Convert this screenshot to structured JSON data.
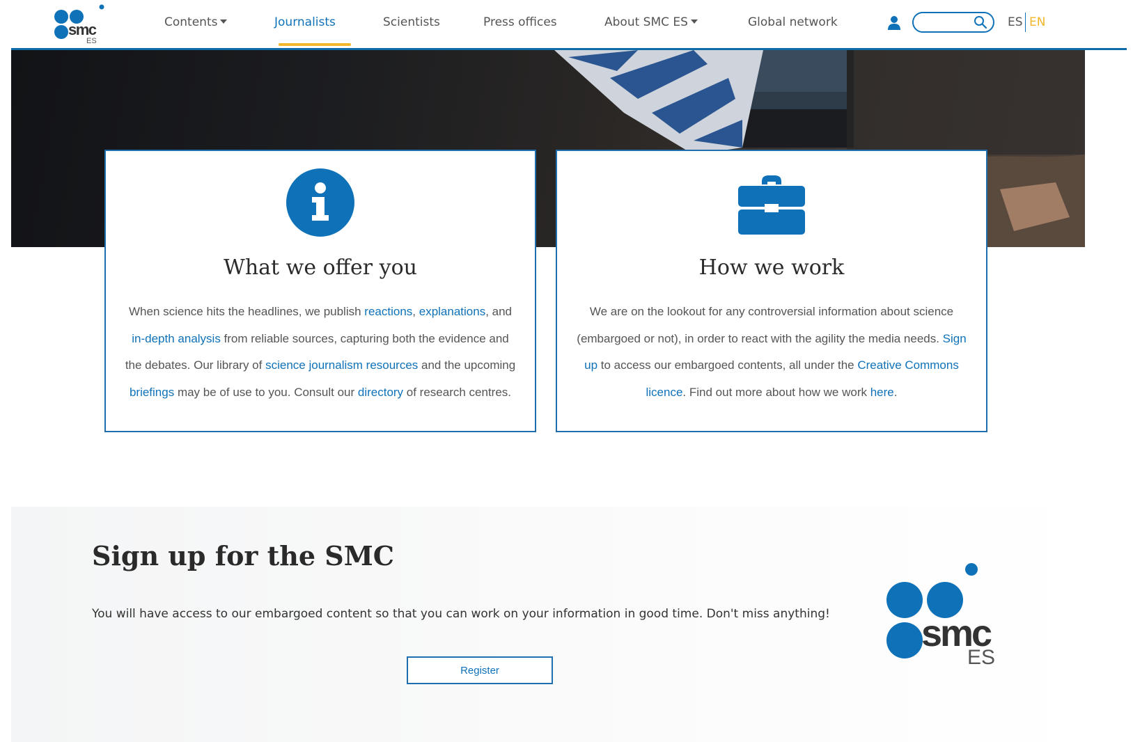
{
  "nav": {
    "logo_text": "smc",
    "logo_sub": "ES",
    "items": [
      {
        "label": "Contents",
        "dropdown": true
      },
      {
        "label": "Journalists",
        "active": true
      },
      {
        "label": "Scientists"
      },
      {
        "label": "Press offices"
      },
      {
        "label": "About SMC ES",
        "dropdown": true
      },
      {
        "label": "Global network"
      }
    ],
    "search_placeholder": "",
    "lang_es": "ES",
    "lang_en": "EN"
  },
  "colors": {
    "brand_blue": "#0f72b9",
    "accent_yellow": "#f2b72a"
  },
  "cards": [
    {
      "icon": "info-circle-icon",
      "title": "What we offer you",
      "parts": [
        {
          "t": "When science hits the headlines, we publish "
        },
        {
          "t": "reactions",
          "link": true
        },
        {
          "t": ", "
        },
        {
          "t": "explanations",
          "link": true
        },
        {
          "t": ", and "
        },
        {
          "t": "in-depth analysis",
          "link": true
        },
        {
          "t": " from reliable sources, capturing both the evidence and the debates. Our library of "
        },
        {
          "t": "science journalism resources",
          "link": true
        },
        {
          "t": " and the upcoming "
        },
        {
          "t": "briefings",
          "link": true
        },
        {
          "t": " may be of use to you. Consult our "
        },
        {
          "t": "directory",
          "link": true
        },
        {
          "t": " of research centres."
        }
      ]
    },
    {
      "icon": "briefcase-icon",
      "title": "How we work",
      "parts": [
        {
          "t": "We are on the lookout for any controversial information about science (embargoed or not), in order to react with the agility the media needs. "
        },
        {
          "t": "Sign up",
          "link": true
        },
        {
          "t": " to access our embargoed contents, all under the "
        },
        {
          "t": "Creative Commons licence",
          "link": true
        },
        {
          "t": ". Find out more about how we work "
        },
        {
          "t": "here",
          "link": true
        },
        {
          "t": "."
        }
      ]
    }
  ],
  "signup": {
    "title": "Sign up for the SMC",
    "text": "You will have access to our embargoed content so that you can work on your information in good time. Don't miss anything!",
    "button": "Register",
    "logo_text": "smc",
    "logo_sub": "ES"
  }
}
